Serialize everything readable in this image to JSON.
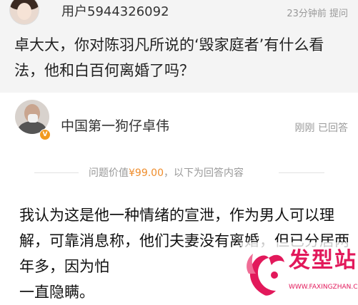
{
  "question": {
    "username": "用户5944326092",
    "meta": "23分钟前 提问",
    "text": "卓大大，你对陈羽凡所说的‘毁家庭者’有什么看法，他和白百何离婚了吗？"
  },
  "answer": {
    "author": "中国第一狗仔卓伟",
    "badge": "V",
    "status": "刚刚 已回答",
    "price_prefix": "问题价值",
    "price": "¥99.00",
    "price_suffix": "，以下为回答内容",
    "text": "我认为这是他一种情绪的宣泄，作为男人可以理解，可靠消息称，他们夫妻没有离婚，但已分居两年多，因为怕",
    "text_tail": "一直隐瞒。"
  },
  "watermark": {
    "name": "发型站",
    "url": "WWW.FAXINGZHAN.COM",
    "color": "#e2195b"
  }
}
